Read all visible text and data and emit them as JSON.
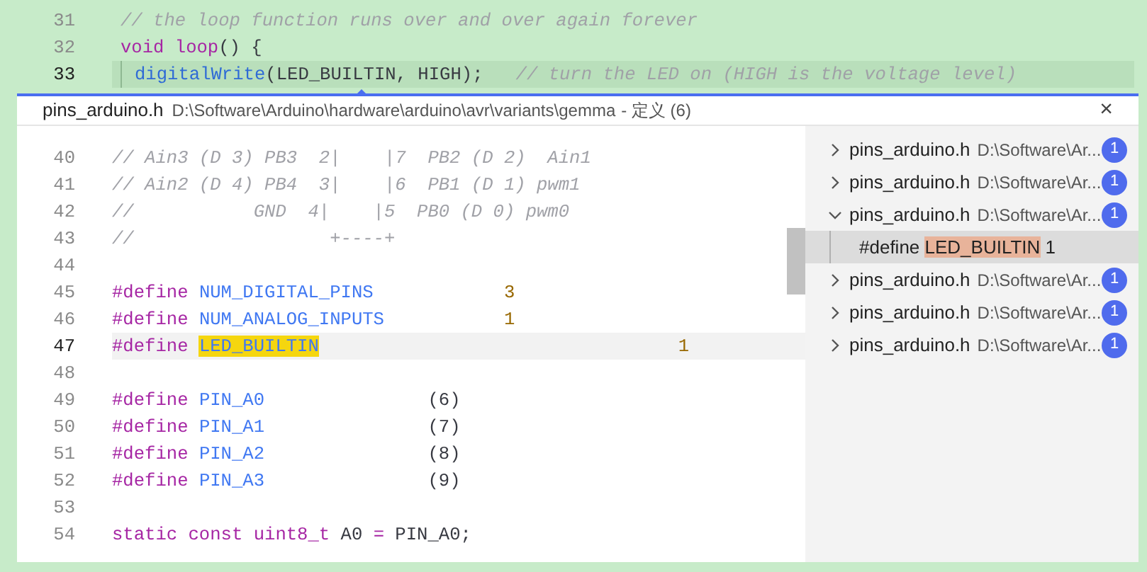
{
  "editor": {
    "lines": [
      {
        "number": "31",
        "current": false,
        "tokens": [
          {
            "kind": "comment",
            "text": "// the loop function runs over and over again forever"
          }
        ]
      },
      {
        "number": "32",
        "current": false,
        "tokens": [
          {
            "kind": "keyword",
            "text": "void loop"
          },
          {
            "kind": "plain",
            "text": "() {"
          }
        ]
      },
      {
        "number": "33",
        "current": true,
        "indent": true,
        "tokens": [
          {
            "kind": "function",
            "text": "digitalWrite"
          },
          {
            "kind": "plain",
            "text": "(LED_BUILTIN, HIGH);"
          },
          {
            "kind": "comment",
            "text": "   // turn the LED on (HIGH is the voltage level)"
          }
        ]
      }
    ]
  },
  "peek": {
    "file": "pins_arduino.h",
    "path": "D:\\Software\\Arduino\\hardware\\arduino\\avr\\variants\\gemma",
    "title": "- 定义 (6)",
    "close": "×",
    "code_lines": [
      {
        "number": "40",
        "current": false,
        "tokens": [
          {
            "kind": "comment",
            "text": "// Ain3 (D 3) PB3  2|    |7  PB2 (D 2)  Ain1"
          }
        ]
      },
      {
        "number": "41",
        "current": false,
        "tokens": [
          {
            "kind": "comment",
            "text": "// Ain2 (D 4) PB4  3|    |6  PB1 (D 1) pwm1"
          }
        ]
      },
      {
        "number": "42",
        "current": false,
        "tokens": [
          {
            "kind": "comment",
            "text": "//           GND  4|    |5  PB0 (D 0) pwm0"
          }
        ]
      },
      {
        "number": "43",
        "current": false,
        "tokens": [
          {
            "kind": "comment",
            "text": "//                  +----+"
          }
        ]
      },
      {
        "number": "44",
        "current": false
      },
      {
        "number": "45",
        "current": false,
        "tokens": [
          {
            "kind": "keyword",
            "text": "#define "
          },
          {
            "kind": "macro",
            "text": "NUM_DIGITAL_PINS"
          },
          {
            "kind": "number",
            "text": "            3"
          }
        ]
      },
      {
        "number": "46",
        "current": false,
        "tokens": [
          {
            "kind": "keyword",
            "text": "#define "
          },
          {
            "kind": "macro",
            "text": "NUM_ANALOG_INPUTS"
          },
          {
            "kind": "number",
            "text": "           1"
          }
        ]
      },
      {
        "number": "47",
        "current": true,
        "tokens": [
          {
            "kind": "keyword",
            "text": "#define "
          },
          {
            "kind": "highlight",
            "text": "LED_BUILTIN"
          },
          {
            "kind": "number",
            "text": "                                 1"
          }
        ]
      },
      {
        "number": "48",
        "current": false
      },
      {
        "number": "49",
        "current": false,
        "tokens": [
          {
            "kind": "keyword",
            "text": "#define "
          },
          {
            "kind": "macro",
            "text": "PIN_A0"
          },
          {
            "kind": "plain",
            "text": "               (6)"
          }
        ]
      },
      {
        "number": "50",
        "current": false,
        "tokens": [
          {
            "kind": "keyword",
            "text": "#define "
          },
          {
            "kind": "macro",
            "text": "PIN_A1"
          },
          {
            "kind": "plain",
            "text": "               (7)"
          }
        ]
      },
      {
        "number": "51",
        "current": false,
        "tokens": [
          {
            "kind": "keyword",
            "text": "#define "
          },
          {
            "kind": "macro",
            "text": "PIN_A2"
          },
          {
            "kind": "plain",
            "text": "               (8)"
          }
        ]
      },
      {
        "number": "52",
        "current": false,
        "tokens": [
          {
            "kind": "keyword",
            "text": "#define "
          },
          {
            "kind": "macro",
            "text": "PIN_A3"
          },
          {
            "kind": "plain",
            "text": "               (9)"
          }
        ]
      },
      {
        "number": "53",
        "current": false
      },
      {
        "number": "54",
        "current": false,
        "tokens": [
          {
            "kind": "keyword",
            "text": "static const uint8_t"
          },
          {
            "kind": "plain",
            "text": " A0 "
          },
          {
            "kind": "keyword",
            "text": "="
          },
          {
            "kind": "plain",
            "text": " PIN_A0;"
          }
        ]
      }
    ],
    "references": [
      {
        "file": "pins_arduino.h",
        "path": "D:\\Software\\Ar...",
        "count": "1",
        "expanded": false
      },
      {
        "file": "pins_arduino.h",
        "path": "D:\\Software\\Ar...",
        "count": "1",
        "expanded": false
      },
      {
        "file": "pins_arduino.h",
        "path": "D:\\Software\\Ar...",
        "count": "1",
        "expanded": true,
        "children": [
          {
            "selected": true,
            "before": "#define ",
            "match": "LED_BUILTIN",
            "after": " 1"
          }
        ]
      },
      {
        "file": "pins_arduino.h",
        "path": "D:\\Software\\Ar...",
        "count": "1",
        "expanded": false
      },
      {
        "file": "pins_arduino.h",
        "path": "D:\\Software\\Ar...",
        "count": "1",
        "expanded": false
      },
      {
        "file": "pins_arduino.h",
        "path": "D:\\Software\\Ar...",
        "count": "1",
        "expanded": false
      }
    ]
  }
}
